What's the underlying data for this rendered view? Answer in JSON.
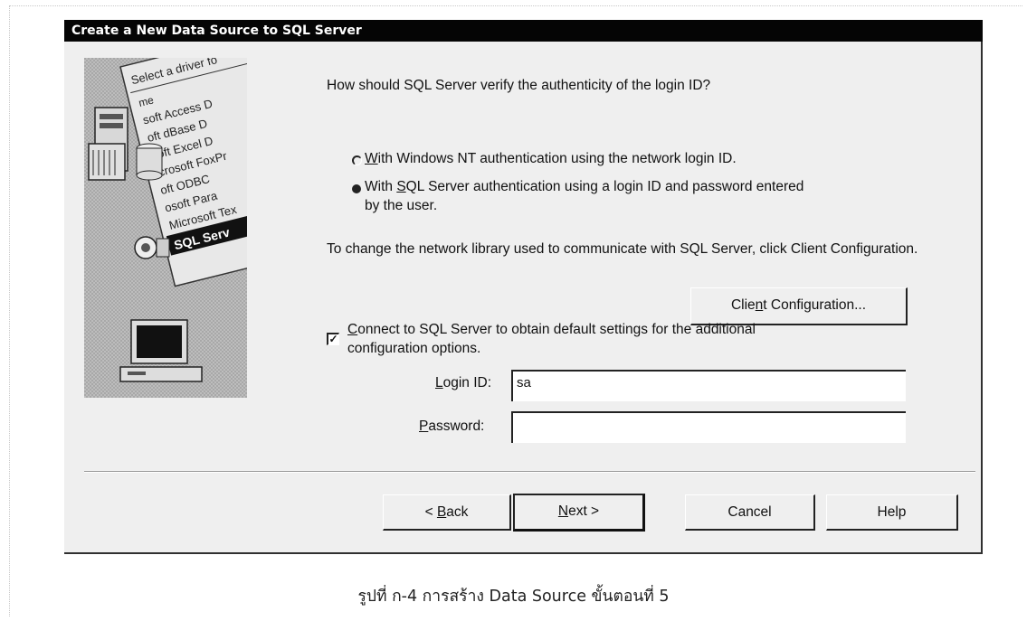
{
  "window": {
    "title": "Create a New Data Source to SQL Server"
  },
  "illustration": {
    "list_items": [
      "Select a driver fo",
      "me",
      "soft Access D",
      "oft dBase D",
      "soft Excel D",
      "icrosoft FoxPr",
      "oft ODBC",
      "osoft Para",
      "Microsoft Tex",
      "SQL Serv"
    ]
  },
  "auth": {
    "question": "How should SQL Server verify the authenticity of the login ID?",
    "option_nt_prefix": "",
    "option_nt_key": "W",
    "option_nt_rest": "ith Windows NT authentication using the network login ID.",
    "option_nt_selected": false,
    "option_sql_prefix": "With ",
    "option_sql_key": "S",
    "option_sql_rest": "QL Server authentication using a login ID and password entered",
    "option_sql_line2": "by the user.",
    "option_sql_selected": true
  },
  "network": {
    "text": "To change the network library used to communicate with SQL Server, click Client Configuration.",
    "client_config_prefix": "Clie",
    "client_config_key": "n",
    "client_config_rest": "t Configuration..."
  },
  "connect": {
    "checked": true,
    "check_mark": "✓",
    "label_key": "C",
    "label_rest": "onnect to SQL Server to obtain default settings for the additional",
    "label_line2": "configuration options."
  },
  "login": {
    "login_key": "L",
    "login_rest": "ogin ID:",
    "login_value": "sa",
    "password_key": "P",
    "password_rest": "assword:",
    "password_value": ""
  },
  "buttons": {
    "back_prefix": "< ",
    "back_key": "B",
    "back_rest": "ack",
    "next_key": "N",
    "next_rest": "ext >",
    "cancel": "Cancel",
    "help": "Help"
  },
  "caption": "รูปที่ ก-4 การสร้าง Data Source ขั้นตอนที่ 5"
}
